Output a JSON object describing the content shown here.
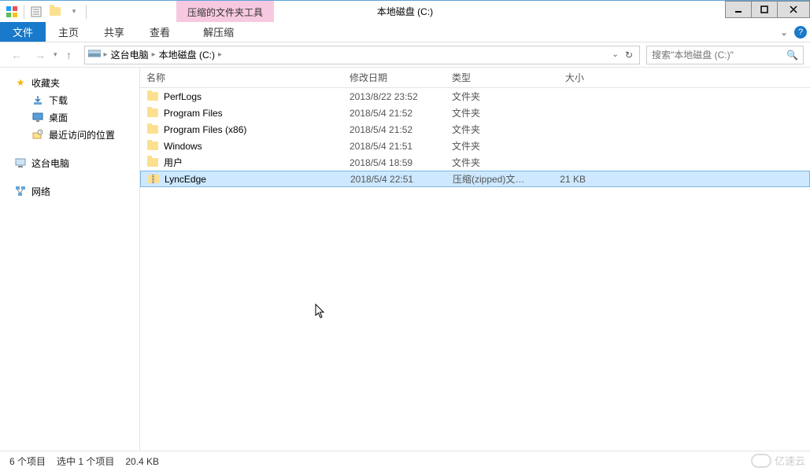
{
  "titlebar": {
    "contextual_label": "压缩的文件夹工具",
    "title": "本地磁盘 (C:)"
  },
  "ribbon": {
    "file": "文件",
    "tabs": [
      "主页",
      "共享",
      "查看"
    ],
    "contextual_tab": "解压缩"
  },
  "address": {
    "crumbs": [
      "这台电脑",
      "本地磁盘 (C:)"
    ]
  },
  "search": {
    "placeholder": "搜索\"本地磁盘 (C:)\""
  },
  "sidebar": {
    "groups": [
      {
        "label": "收藏夹",
        "icon": "star",
        "children": [
          {
            "label": "下载",
            "icon": "download"
          },
          {
            "label": "桌面",
            "icon": "desktop"
          },
          {
            "label": "最近访问的位置",
            "icon": "recent"
          }
        ]
      },
      {
        "label": "这台电脑",
        "icon": "computer",
        "selected": true
      },
      {
        "label": "网络",
        "icon": "network"
      }
    ]
  },
  "columns": {
    "name": "名称",
    "date": "修改日期",
    "type": "类型",
    "size": "大小"
  },
  "rows": [
    {
      "name": "PerfLogs",
      "date": "2013/8/22 23:52",
      "type": "文件夹",
      "size": "",
      "icon": "folder"
    },
    {
      "name": "Program Files",
      "date": "2018/5/4 21:52",
      "type": "文件夹",
      "size": "",
      "icon": "folder"
    },
    {
      "name": "Program Files (x86)",
      "date": "2018/5/4 21:52",
      "type": "文件夹",
      "size": "",
      "icon": "folder"
    },
    {
      "name": "Windows",
      "date": "2018/5/4 21:51",
      "type": "文件夹",
      "size": "",
      "icon": "folder"
    },
    {
      "name": "用户",
      "date": "2018/5/4 18:59",
      "type": "文件夹",
      "size": "",
      "icon": "folder"
    },
    {
      "name": "LyncEdge",
      "date": "2018/5/4 22:51",
      "type": "压缩(zipped)文件...",
      "size": "21 KB",
      "icon": "zip",
      "selected": true
    }
  ],
  "status": {
    "count": "6 个项目",
    "selection": "选中 1 个项目",
    "size": "20.4 KB"
  },
  "watermark": "亿速云"
}
